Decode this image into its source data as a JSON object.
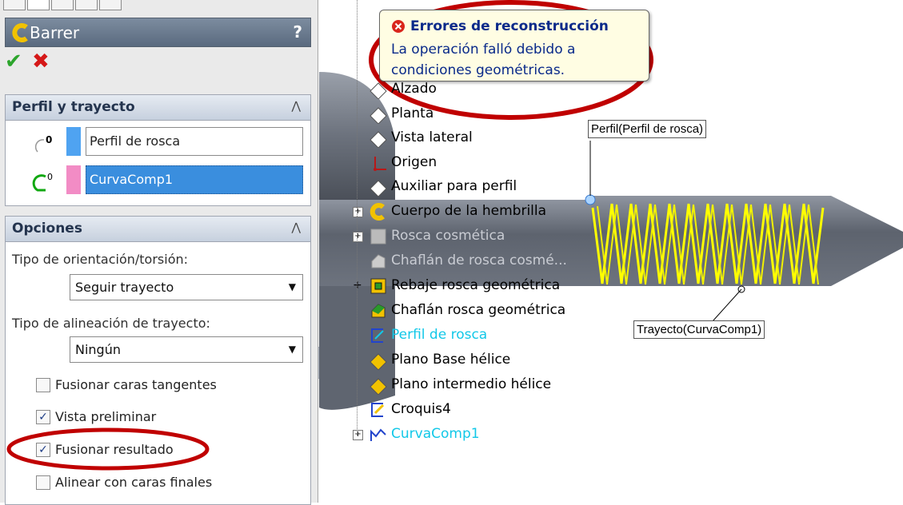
{
  "property_manager": {
    "title": "Barrer",
    "help": "?",
    "ok_symbol": "✔",
    "cancel_symbol": "✖",
    "profile_group": {
      "title": "Perfil y trayecto",
      "profile_value": "Perfil de rosca",
      "path_value": "CurvaComp1",
      "profile_color": "#4fa3f1",
      "path_color": "#f28cc5"
    },
    "options_group": {
      "title": "Opciones",
      "orientation_label": "Tipo de orientación/torsión:",
      "orientation_value": "Seguir trayecto",
      "alignment_label": "Tipo de alineación de trayecto:",
      "alignment_value": "Ningún",
      "checkboxes": [
        {
          "label": "Fusionar caras tangentes",
          "checked": false
        },
        {
          "label": "Vista preliminar",
          "checked": true
        },
        {
          "label": "Fusionar resultado",
          "checked": true
        },
        {
          "label": "Alinear con caras finales",
          "checked": false
        }
      ]
    }
  },
  "feature_tree": [
    {
      "label": "Alzado",
      "icon": "plane-icon"
    },
    {
      "label": "Planta",
      "icon": "plane-icon"
    },
    {
      "label": "Vista lateral",
      "icon": "plane-icon"
    },
    {
      "label": "Origen",
      "icon": "origin-icon"
    },
    {
      "label": "Auxiliar para perfil",
      "icon": "plane-icon"
    },
    {
      "label": "Cuerpo de la hembrilla",
      "icon": "revolve-icon"
    },
    {
      "label": "Rosca cosmética",
      "icon": "cosmetic-thread-icon"
    },
    {
      "label": "Chaflán de rosca cosmé...",
      "icon": "chamfer-icon"
    },
    {
      "label": "Rebaje rosca geométrica",
      "icon": "cut-icon"
    },
    {
      "label": "Chaflán rosca geométrica",
      "icon": "chamfer-icon"
    },
    {
      "label": "Perfil de rosca",
      "icon": "sketch-icon"
    },
    {
      "label": "Plano  Base hélice",
      "icon": "plane-icon"
    },
    {
      "label": "Plano intermedio hélice",
      "icon": "plane-icon"
    },
    {
      "label": "Croquis4",
      "icon": "sketch-icon"
    },
    {
      "label": "CurvaComp1",
      "icon": "composite-curve-icon"
    }
  ],
  "tooltip": {
    "title": "Errores de reconstrucción",
    "message": "La operación falló debido a condiciones geométricas."
  },
  "callouts": {
    "profile": "Perfil(Perfil de rosca)",
    "path": "Trayecto(CurvaComp1)"
  },
  "colors": {
    "highlight_tree_text": "#12c8e8",
    "annotation_red": "#c00000",
    "helix_yellow": "#ffff00",
    "selection_blue": "#3a8ede"
  }
}
